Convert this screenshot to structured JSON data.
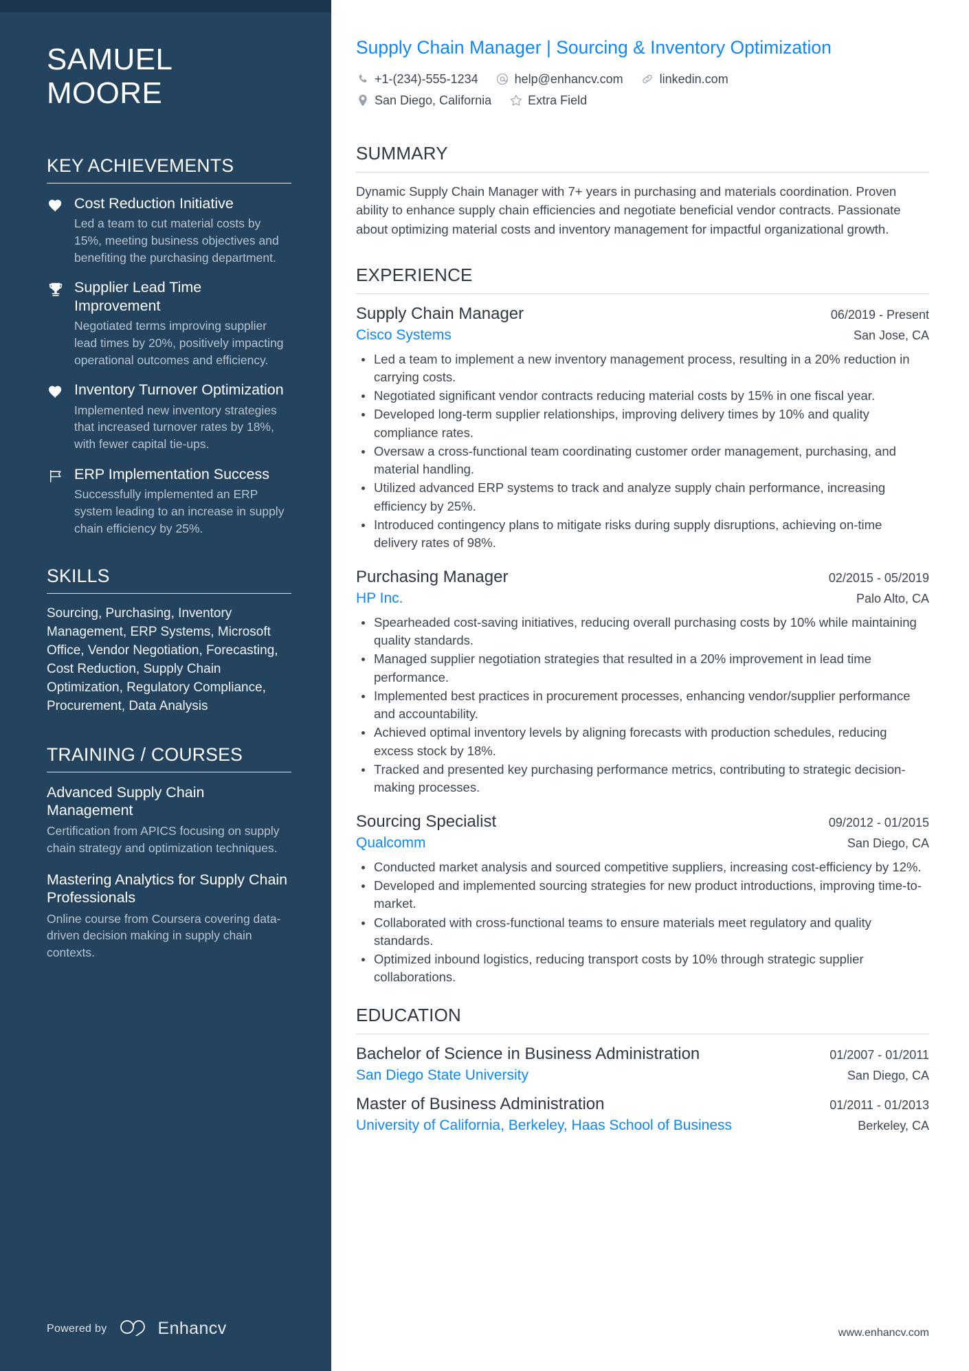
{
  "sidebar": {
    "name": {
      "first": "SAMUEL",
      "last": "MOORE"
    },
    "achievements_section": {
      "title": "KEY ACHIEVEMENTS",
      "items": [
        {
          "icon": "heart-icon",
          "title": "Cost Reduction Initiative",
          "description": "Led a team to cut material costs by 15%, meeting business objectives and benefiting the purchasing department."
        },
        {
          "icon": "trophy-icon",
          "title": "Supplier Lead Time Improvement",
          "description": "Negotiated terms improving supplier lead times by 20%, positively impacting operational outcomes and efficiency."
        },
        {
          "icon": "heart-icon",
          "title": "Inventory Turnover Optimization",
          "description": "Implemented new inventory strategies that increased turnover rates by 18%, with fewer capital tie-ups."
        },
        {
          "icon": "flag-icon",
          "title": "ERP Implementation Success",
          "description": "Successfully implemented an ERP system leading to an increase in supply chain efficiency by 25%."
        }
      ]
    },
    "skills_section": {
      "title": "SKILLS",
      "text": "Sourcing, Purchasing, Inventory Management, ERP Systems, Microsoft Office, Vendor Negotiation, Forecasting, Cost Reduction, Supply Chain Optimization, Regulatory Compliance, Procurement, Data Analysis"
    },
    "training_section": {
      "title": "TRAINING / COURSES",
      "items": [
        {
          "title": "Advanced Supply Chain Management",
          "description": "Certification from APICS focusing on supply chain strategy and optimization techniques."
        },
        {
          "title": "Mastering Analytics for Supply Chain Professionals",
          "description": "Online course from Coursera covering data-driven decision making in supply chain contexts."
        }
      ]
    },
    "footer": {
      "powered_by": "Powered by",
      "brand": "Enhancv"
    }
  },
  "main": {
    "headline": "Supply Chain Manager | Sourcing & Inventory Optimization",
    "contact": {
      "row1": [
        {
          "icon": "phone-icon",
          "text": "+1-(234)-555-1234"
        },
        {
          "icon": "at-icon",
          "text": "help@enhancv.com"
        },
        {
          "icon": "link-icon",
          "text": "linkedin.com"
        }
      ],
      "row2": [
        {
          "icon": "location-pin-icon",
          "text": "San Diego, California"
        },
        {
          "icon": "star-icon",
          "text": "Extra Field"
        }
      ]
    },
    "summary_section": {
      "title": "SUMMARY",
      "text": "Dynamic Supply Chain Manager with 7+ years in purchasing and materials coordination. Proven ability to enhance supply chain efficiencies and negotiate beneficial vendor contracts. Passionate about optimizing material costs and inventory management for impactful organizational growth."
    },
    "experience_section": {
      "title": "EXPERIENCE",
      "entries": [
        {
          "title": "Supply Chain Manager",
          "organization": "Cisco Systems",
          "date": "06/2019 - Present",
          "location": "San Jose, CA",
          "bullets": [
            "Led a team to implement a new inventory management process, resulting in a 20% reduction in carrying costs.",
            "Negotiated significant vendor contracts reducing material costs by 15% in one fiscal year.",
            "Developed long-term supplier relationships, improving delivery times by 10% and quality compliance rates.",
            "Oversaw a cross-functional team coordinating customer order management, purchasing, and material handling.",
            "Utilized advanced ERP systems to track and analyze supply chain performance, increasing efficiency by 25%.",
            "Introduced contingency plans to mitigate risks during supply disruptions, achieving on-time delivery rates of 98%."
          ]
        },
        {
          "title": "Purchasing Manager",
          "organization": "HP Inc.",
          "date": "02/2015 - 05/2019",
          "location": "Palo Alto, CA",
          "bullets": [
            "Spearheaded cost-saving initiatives, reducing overall purchasing costs by 10% while maintaining quality standards.",
            "Managed supplier negotiation strategies that resulted in a 20% improvement in lead time performance.",
            "Implemented best practices in procurement processes, enhancing vendor/supplier performance and accountability.",
            "Achieved optimal inventory levels by aligning forecasts with production schedules, reducing excess stock by 18%.",
            "Tracked and presented key purchasing performance metrics, contributing to strategic decision-making processes."
          ]
        },
        {
          "title": "Sourcing Specialist",
          "organization": "Qualcomm",
          "date": "09/2012 - 01/2015",
          "location": "San Diego, CA",
          "bullets": [
            "Conducted market analysis and sourced competitive suppliers, increasing cost-efficiency by 12%.",
            "Developed and implemented sourcing strategies for new product introductions, improving time-to-market.",
            "Collaborated with cross-functional teams to ensure materials meet regulatory and quality standards.",
            "Optimized inbound logistics, reducing transport costs by 10% through strategic supplier collaborations."
          ]
        }
      ]
    },
    "education_section": {
      "title": "EDUCATION",
      "entries": [
        {
          "title": "Bachelor of Science in Business Administration",
          "organization": "San Diego State University",
          "date": "01/2007 - 01/2011",
          "location": "San Diego, CA"
        },
        {
          "title": "Master of Business Administration",
          "organization": "University of California, Berkeley, Haas School of Business",
          "date": "01/2011 - 01/2013",
          "location": "Berkeley, CA"
        }
      ]
    },
    "footer": {
      "website": "www.enhancv.com"
    }
  },
  "colors": {
    "sidebar_bg": "#24435f",
    "sidebar_topband": "#1b3450",
    "accent_blue": "#0f87f7",
    "heading_dark": "#2e3742",
    "body_text": "#3d4650",
    "muted_sidebar_text": "#b8c4cf"
  }
}
